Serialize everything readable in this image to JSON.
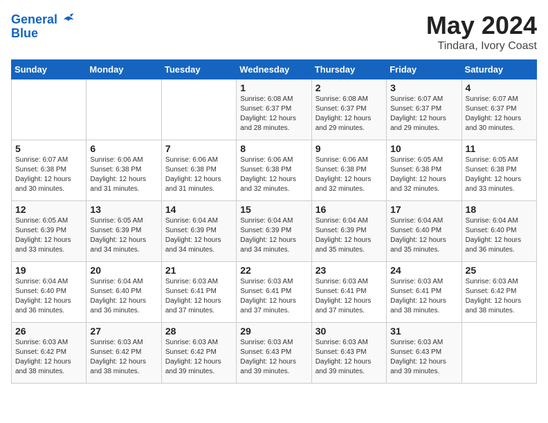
{
  "logo": {
    "line1": "General",
    "line2": "Blue"
  },
  "title": "May 2024",
  "subtitle": "Tindara, Ivory Coast",
  "days_of_week": [
    "Sunday",
    "Monday",
    "Tuesday",
    "Wednesday",
    "Thursday",
    "Friday",
    "Saturday"
  ],
  "weeks": [
    [
      {
        "day": "",
        "info": ""
      },
      {
        "day": "",
        "info": ""
      },
      {
        "day": "",
        "info": ""
      },
      {
        "day": "1",
        "info": "Sunrise: 6:08 AM\nSunset: 6:37 PM\nDaylight: 12 hours\nand 28 minutes."
      },
      {
        "day": "2",
        "info": "Sunrise: 6:08 AM\nSunset: 6:37 PM\nDaylight: 12 hours\nand 29 minutes."
      },
      {
        "day": "3",
        "info": "Sunrise: 6:07 AM\nSunset: 6:37 PM\nDaylight: 12 hours\nand 29 minutes."
      },
      {
        "day": "4",
        "info": "Sunrise: 6:07 AM\nSunset: 6:37 PM\nDaylight: 12 hours\nand 30 minutes."
      }
    ],
    [
      {
        "day": "5",
        "info": "Sunrise: 6:07 AM\nSunset: 6:38 PM\nDaylight: 12 hours\nand 30 minutes."
      },
      {
        "day": "6",
        "info": "Sunrise: 6:06 AM\nSunset: 6:38 PM\nDaylight: 12 hours\nand 31 minutes."
      },
      {
        "day": "7",
        "info": "Sunrise: 6:06 AM\nSunset: 6:38 PM\nDaylight: 12 hours\nand 31 minutes."
      },
      {
        "day": "8",
        "info": "Sunrise: 6:06 AM\nSunset: 6:38 PM\nDaylight: 12 hours\nand 32 minutes."
      },
      {
        "day": "9",
        "info": "Sunrise: 6:06 AM\nSunset: 6:38 PM\nDaylight: 12 hours\nand 32 minutes."
      },
      {
        "day": "10",
        "info": "Sunrise: 6:05 AM\nSunset: 6:38 PM\nDaylight: 12 hours\nand 32 minutes."
      },
      {
        "day": "11",
        "info": "Sunrise: 6:05 AM\nSunset: 6:38 PM\nDaylight: 12 hours\nand 33 minutes."
      }
    ],
    [
      {
        "day": "12",
        "info": "Sunrise: 6:05 AM\nSunset: 6:39 PM\nDaylight: 12 hours\nand 33 minutes."
      },
      {
        "day": "13",
        "info": "Sunrise: 6:05 AM\nSunset: 6:39 PM\nDaylight: 12 hours\nand 34 minutes."
      },
      {
        "day": "14",
        "info": "Sunrise: 6:04 AM\nSunset: 6:39 PM\nDaylight: 12 hours\nand 34 minutes."
      },
      {
        "day": "15",
        "info": "Sunrise: 6:04 AM\nSunset: 6:39 PM\nDaylight: 12 hours\nand 34 minutes."
      },
      {
        "day": "16",
        "info": "Sunrise: 6:04 AM\nSunset: 6:39 PM\nDaylight: 12 hours\nand 35 minutes."
      },
      {
        "day": "17",
        "info": "Sunrise: 6:04 AM\nSunset: 6:40 PM\nDaylight: 12 hours\nand 35 minutes."
      },
      {
        "day": "18",
        "info": "Sunrise: 6:04 AM\nSunset: 6:40 PM\nDaylight: 12 hours\nand 36 minutes."
      }
    ],
    [
      {
        "day": "19",
        "info": "Sunrise: 6:04 AM\nSunset: 6:40 PM\nDaylight: 12 hours\nand 36 minutes."
      },
      {
        "day": "20",
        "info": "Sunrise: 6:04 AM\nSunset: 6:40 PM\nDaylight: 12 hours\nand 36 minutes."
      },
      {
        "day": "21",
        "info": "Sunrise: 6:03 AM\nSunset: 6:41 PM\nDaylight: 12 hours\nand 37 minutes."
      },
      {
        "day": "22",
        "info": "Sunrise: 6:03 AM\nSunset: 6:41 PM\nDaylight: 12 hours\nand 37 minutes."
      },
      {
        "day": "23",
        "info": "Sunrise: 6:03 AM\nSunset: 6:41 PM\nDaylight: 12 hours\nand 37 minutes."
      },
      {
        "day": "24",
        "info": "Sunrise: 6:03 AM\nSunset: 6:41 PM\nDaylight: 12 hours\nand 38 minutes."
      },
      {
        "day": "25",
        "info": "Sunrise: 6:03 AM\nSunset: 6:42 PM\nDaylight: 12 hours\nand 38 minutes."
      }
    ],
    [
      {
        "day": "26",
        "info": "Sunrise: 6:03 AM\nSunset: 6:42 PM\nDaylight: 12 hours\nand 38 minutes."
      },
      {
        "day": "27",
        "info": "Sunrise: 6:03 AM\nSunset: 6:42 PM\nDaylight: 12 hours\nand 38 minutes."
      },
      {
        "day": "28",
        "info": "Sunrise: 6:03 AM\nSunset: 6:42 PM\nDaylight: 12 hours\nand 39 minutes."
      },
      {
        "day": "29",
        "info": "Sunrise: 6:03 AM\nSunset: 6:43 PM\nDaylight: 12 hours\nand 39 minutes."
      },
      {
        "day": "30",
        "info": "Sunrise: 6:03 AM\nSunset: 6:43 PM\nDaylight: 12 hours\nand 39 minutes."
      },
      {
        "day": "31",
        "info": "Sunrise: 6:03 AM\nSunset: 6:43 PM\nDaylight: 12 hours\nand 39 minutes."
      },
      {
        "day": "",
        "info": ""
      }
    ]
  ]
}
